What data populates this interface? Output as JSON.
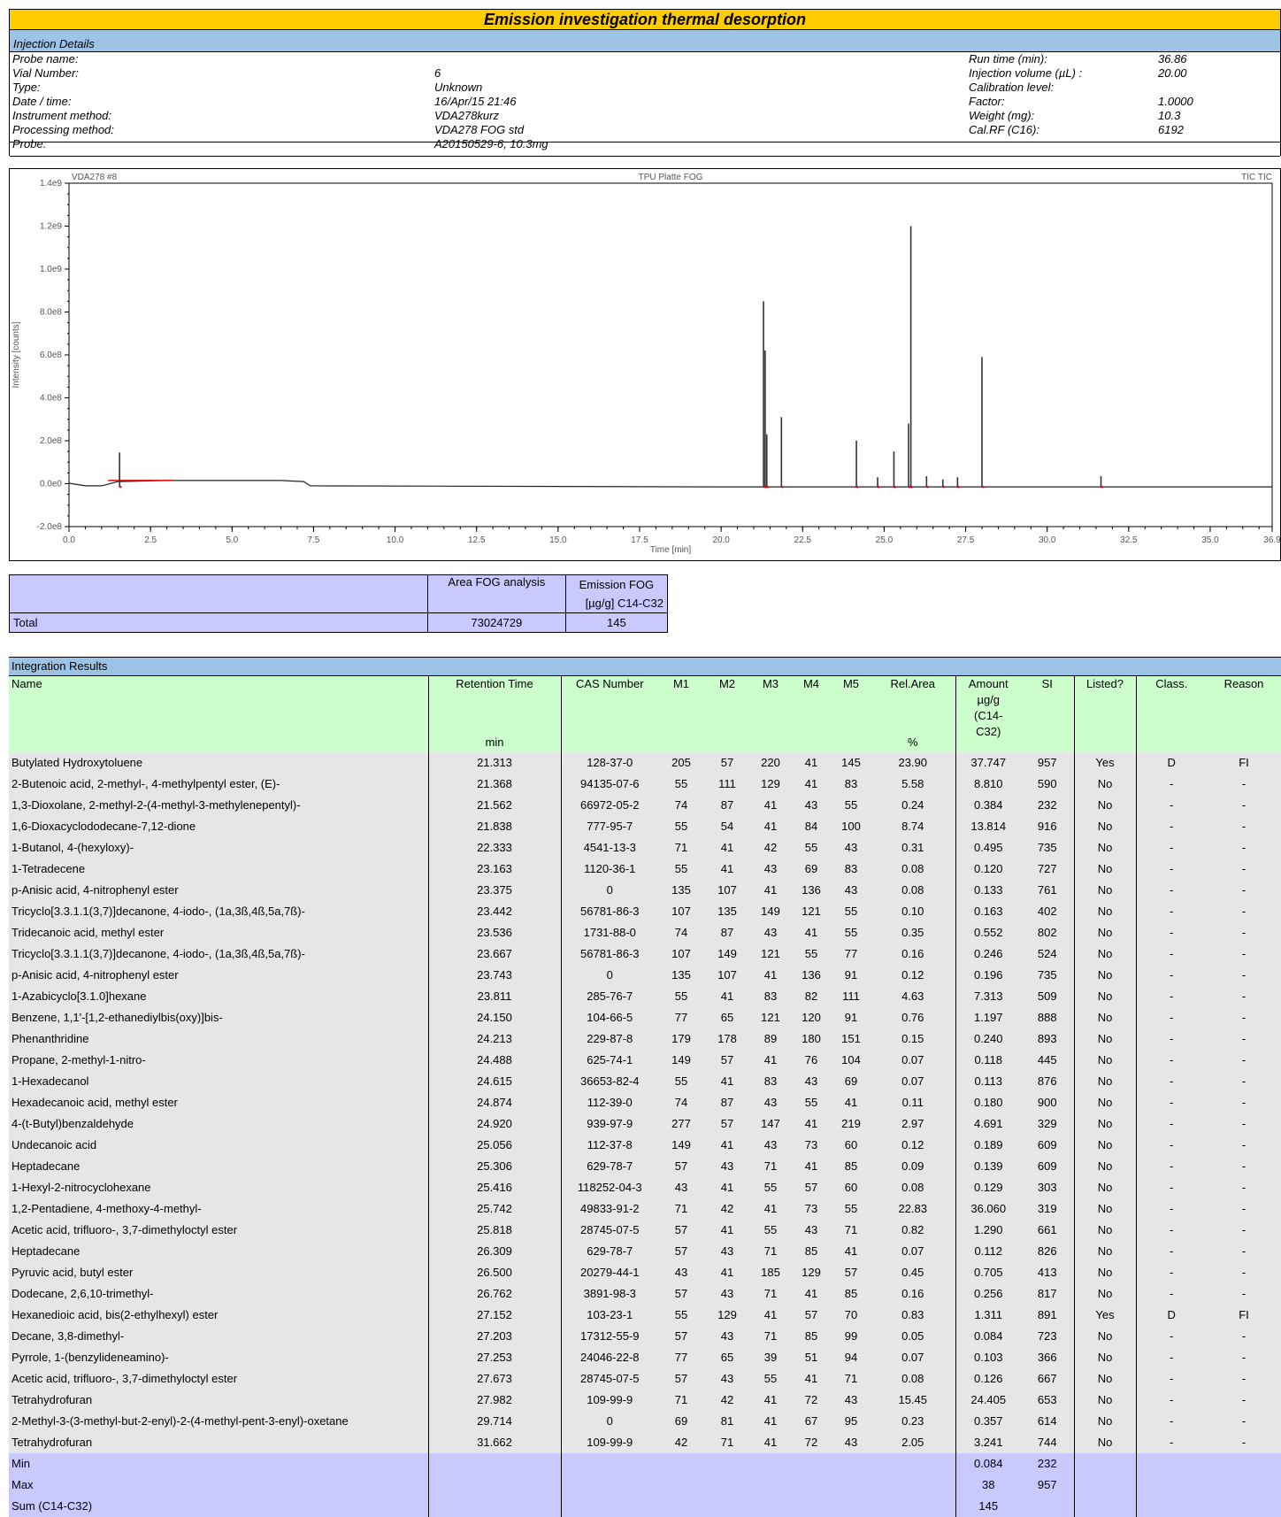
{
  "title": "Emission investigation thermal desorption",
  "injection": {
    "header": "Injection Details",
    "left_labels": [
      "Probe name:",
      "Vial Number:",
      "Type:",
      "Date / time:",
      "Instrument method:",
      "Processing method:",
      "Probe:"
    ],
    "left_values": [
      "",
      "6",
      "Unknown",
      "16/Apr/15 21:46",
      "VDA278kurz",
      "VDA278 FOG std",
      "A20150529-6, 10.3mg"
    ],
    "right_labels": [
      "Run time (min):",
      "Injection volume (µL) :",
      "Calibration level:",
      "Factor:",
      "Weight (mg):",
      "Cal.RF (C16):"
    ],
    "right_values": [
      "36.86",
      "20.00",
      "",
      "1.0000",
      "10.3",
      "6192"
    ]
  },
  "chart_data": {
    "type": "line",
    "title": "TPU Platte FOG",
    "corner_left": "VDA278 #8",
    "corner_right": "TIC TIC",
    "xlabel": "Time [min]",
    "ylabel": "Intensity [counts]",
    "xlim": [
      0,
      36.9
    ],
    "ylim": [
      -200000000.0,
      1400000000.0
    ],
    "x_ticks": [
      "0.0",
      "2.5",
      "5.0",
      "7.5",
      "10.0",
      "12.5",
      "15.0",
      "17.5",
      "20.0",
      "22.5",
      "25.0",
      "27.5",
      "30.0",
      "32.5",
      "35.0",
      "36.9"
    ],
    "y_ticks": [
      "1.4e9",
      "1.2e9",
      "1.0e9",
      "8.0e8",
      "6.0e8",
      "4.0e8",
      "2.0e8",
      "0.0e0",
      "-2.0e8"
    ],
    "baseline": [
      [
        0.0,
        2000000.0
      ],
      [
        0.5,
        -10000000.0
      ],
      [
        1.0,
        -10000000.0
      ],
      [
        1.5,
        10000000.0
      ],
      [
        3.0,
        15000000.0
      ],
      [
        6.5,
        15000000.0
      ],
      [
        7.2,
        10000000.0
      ],
      [
        7.4,
        -10000000.0
      ],
      [
        20.0,
        -15000000.0
      ],
      [
        36.9,
        -15000000.0
      ]
    ],
    "peaks": [
      [
        1.55,
        145000000.0
      ],
      [
        21.3,
        850000000.0
      ],
      [
        21.35,
        620000000.0
      ],
      [
        21.4,
        230000000.0
      ],
      [
        21.85,
        310000000.0
      ],
      [
        24.15,
        200000000.0
      ],
      [
        24.8,
        30000000.0
      ],
      [
        25.3,
        150000000.0
      ],
      [
        25.75,
        280000000.0
      ],
      [
        25.82,
        1200000000.0
      ],
      [
        26.3,
        35000000.0
      ],
      [
        26.8,
        20000000.0
      ],
      [
        27.25,
        30000000.0
      ],
      [
        28.0,
        590000000.0
      ],
      [
        31.65,
        35000000.0
      ]
    ]
  },
  "total": {
    "col1": "Area FOG analysis",
    "col2_line1": "Emission FOG",
    "col2_line2": "[µg/g] C14-C32",
    "row_label": "Total",
    "area": "73024729",
    "emission": "145"
  },
  "results": {
    "section": "Integration Results",
    "headers": {
      "name": "Name",
      "rt": "Retention Time",
      "rt_unit": "min",
      "cas": "CAS Number",
      "m1": "M1",
      "m2": "M2",
      "m3": "M3",
      "m4": "M4",
      "m5": "M5",
      "rel": "Rel.Area",
      "rel_unit": "%",
      "amount": "Amount",
      "amount_unit1": "µg/g",
      "amount_unit2": "(C14-",
      "amount_unit3": "C32)",
      "si": "SI",
      "listed": "Listed?",
      "class": "Class.",
      "reason": "Reason"
    },
    "rows": [
      [
        "Butylated Hydroxytoluene",
        "21.313",
        "128-37-0",
        "205",
        "57",
        "220",
        "41",
        "145",
        "23.90",
        "37.747",
        "957",
        "Yes",
        "D",
        "FI"
      ],
      [
        "2-Butenoic acid, 2-methyl-, 4-methylpentyl ester, (E)-",
        "21.368",
        "94135-07-6",
        "55",
        "111",
        "129",
        "41",
        "83",
        "5.58",
        "8.810",
        "590",
        "No",
        "-",
        "-"
      ],
      [
        "1,3-Dioxolane, 2-methyl-2-(4-methyl-3-methylenepentyl)-",
        "21.562",
        "66972-05-2",
        "74",
        "87",
        "41",
        "43",
        "55",
        "0.24",
        "0.384",
        "232",
        "No",
        "-",
        "-"
      ],
      [
        "1,6-Dioxacyclododecane-7,12-dione",
        "21.838",
        "777-95-7",
        "55",
        "54",
        "41",
        "84",
        "100",
        "8.74",
        "13.814",
        "916",
        "No",
        "-",
        "-"
      ],
      [
        "1-Butanol, 4-(hexyloxy)-",
        "22.333",
        "4541-13-3",
        "71",
        "41",
        "42",
        "55",
        "43",
        "0.31",
        "0.495",
        "735",
        "No",
        "-",
        "-"
      ],
      [
        "1-Tetradecene",
        "23.163",
        "1120-36-1",
        "55",
        "41",
        "43",
        "69",
        "83",
        "0.08",
        "0.120",
        "727",
        "No",
        "-",
        "-"
      ],
      [
        "p-Anisic acid, 4-nitrophenyl ester",
        "23.375",
        "0",
        "135",
        "107",
        "41",
        "136",
        "43",
        "0.08",
        "0.133",
        "761",
        "No",
        "-",
        "-"
      ],
      [
        "Tricyclo[3.3.1.1(3,7)]decanone, 4-iodo-, (1a,3ß,4ß,5a,7ß)-",
        "23.442",
        "56781-86-3",
        "107",
        "135",
        "149",
        "121",
        "55",
        "0.10",
        "0.163",
        "402",
        "No",
        "-",
        "-"
      ],
      [
        "Tridecanoic acid, methyl ester",
        "23.536",
        "1731-88-0",
        "74",
        "87",
        "43",
        "41",
        "55",
        "0.35",
        "0.552",
        "802",
        "No",
        "-",
        "-"
      ],
      [
        "Tricyclo[3.3.1.1(3,7)]decanone, 4-iodo-, (1a,3ß,4ß,5a,7ß)-",
        "23.667",
        "56781-86-3",
        "107",
        "149",
        "121",
        "55",
        "77",
        "0.16",
        "0.246",
        "524",
        "No",
        "-",
        "-"
      ],
      [
        "p-Anisic acid, 4-nitrophenyl ester",
        "23.743",
        "0",
        "135",
        "107",
        "41",
        "136",
        "91",
        "0.12",
        "0.196",
        "735",
        "No",
        "-",
        "-"
      ],
      [
        "1-Azabicyclo[3.1.0]hexane",
        "23.811",
        "285-76-7",
        "55",
        "41",
        "83",
        "82",
        "111",
        "4.63",
        "7.313",
        "509",
        "No",
        "-",
        "-"
      ],
      [
        "Benzene, 1,1'-[1,2-ethanediylbis(oxy)]bis-",
        "24.150",
        "104-66-5",
        "77",
        "65",
        "121",
        "120",
        "91",
        "0.76",
        "1.197",
        "888",
        "No",
        "-",
        "-"
      ],
      [
        "Phenanthridine",
        "24.213",
        "229-87-8",
        "179",
        "178",
        "89",
        "180",
        "151",
        "0.15",
        "0.240",
        "893",
        "No",
        "-",
        "-"
      ],
      [
        "Propane, 2-methyl-1-nitro-",
        "24.488",
        "625-74-1",
        "149",
        "57",
        "41",
        "76",
        "104",
        "0.07",
        "0.118",
        "445",
        "No",
        "-",
        "-"
      ],
      [
        "1-Hexadecanol",
        "24.615",
        "36653-82-4",
        "55",
        "41",
        "83",
        "43",
        "69",
        "0.07",
        "0.113",
        "876",
        "No",
        "-",
        "-"
      ],
      [
        "Hexadecanoic acid, methyl ester",
        "24.874",
        "112-39-0",
        "74",
        "87",
        "43",
        "55",
        "41",
        "0.11",
        "0.180",
        "900",
        "No",
        "-",
        "-"
      ],
      [
        "4-(t-Butyl)benzaldehyde",
        "24.920",
        "939-97-9",
        "277",
        "57",
        "147",
        "41",
        "219",
        "2.97",
        "4.691",
        "329",
        "No",
        "-",
        "-"
      ],
      [
        "Undecanoic acid",
        "25.056",
        "112-37-8",
        "149",
        "41",
        "43",
        "73",
        "60",
        "0.12",
        "0.189",
        "609",
        "No",
        "-",
        "-"
      ],
      [
        "Heptadecane",
        "25.306",
        "629-78-7",
        "57",
        "43",
        "71",
        "41",
        "85",
        "0.09",
        "0.139",
        "609",
        "No",
        "-",
        "-"
      ],
      [
        "1-Hexyl-2-nitrocyclohexane",
        "25.416",
        "118252-04-3",
        "43",
        "41",
        "55",
        "57",
        "60",
        "0.08",
        "0.129",
        "303",
        "No",
        "-",
        "-"
      ],
      [
        "1,2-Pentadiene, 4-methoxy-4-methyl-",
        "25.742",
        "49833-91-2",
        "71",
        "42",
        "41",
        "73",
        "55",
        "22.83",
        "36.060",
        "319",
        "No",
        "-",
        "-"
      ],
      [
        "Acetic acid, trifluoro-, 3,7-dimethyloctyl ester",
        "25.818",
        "28745-07-5",
        "57",
        "41",
        "55",
        "43",
        "71",
        "0.82",
        "1.290",
        "661",
        "No",
        "-",
        "-"
      ],
      [
        "Heptadecane",
        "26.309",
        "629-78-7",
        "57",
        "43",
        "71",
        "85",
        "41",
        "0.07",
        "0.112",
        "826",
        "No",
        "-",
        "-"
      ],
      [
        "Pyruvic acid, butyl ester",
        "26.500",
        "20279-44-1",
        "43",
        "41",
        "185",
        "129",
        "57",
        "0.45",
        "0.705",
        "413",
        "No",
        "-",
        "-"
      ],
      [
        "Dodecane, 2,6,10-trimethyl-",
        "26.762",
        "3891-98-3",
        "57",
        "43",
        "71",
        "41",
        "85",
        "0.16",
        "0.256",
        "817",
        "No",
        "-",
        "-"
      ],
      [
        "Hexanedioic acid, bis(2-ethylhexyl) ester",
        "27.152",
        "103-23-1",
        "55",
        "129",
        "41",
        "57",
        "70",
        "0.83",
        "1.311",
        "891",
        "Yes",
        "D",
        "FI"
      ],
      [
        "Decane, 3,8-dimethyl-",
        "27.203",
        "17312-55-9",
        "57",
        "43",
        "71",
        "85",
        "99",
        "0.05",
        "0.084",
        "723",
        "No",
        "-",
        "-"
      ],
      [
        "Pyrrole, 1-(benzylideneamino)-",
        "27.253",
        "24046-22-8",
        "77",
        "65",
        "39",
        "51",
        "94",
        "0.07",
        "0.103",
        "366",
        "No",
        "-",
        "-"
      ],
      [
        "Acetic acid, trifluoro-, 3,7-dimethyloctyl ester",
        "27.673",
        "28745-07-5",
        "57",
        "43",
        "55",
        "41",
        "71",
        "0.08",
        "0.126",
        "667",
        "No",
        "-",
        "-"
      ],
      [
        "Tetrahydrofuran",
        "27.982",
        "109-99-9",
        "71",
        "42",
        "41",
        "72",
        "43",
        "15.45",
        "24.405",
        "653",
        "No",
        "-",
        "-"
      ],
      [
        "2-Methyl-3-(3-methyl-but-2-enyl)-2-(4-methyl-pent-3-enyl)-oxetane",
        "29.714",
        "0",
        "69",
        "81",
        "41",
        "67",
        "95",
        "0.23",
        "0.357",
        "614",
        "No",
        "-",
        "-"
      ],
      [
        "Tetrahydrofuran",
        "31.662",
        "109-99-9",
        "42",
        "71",
        "41",
        "72",
        "43",
        "2.05",
        "3.241",
        "744",
        "No",
        "-",
        "-"
      ]
    ],
    "footer": [
      {
        "label": "Min",
        "amount": "0.084",
        "si": "232"
      },
      {
        "label": "Max",
        "amount": "38",
        "si": "957"
      },
      {
        "label": "Sum (C14-C32)",
        "amount": "145",
        "si": ""
      }
    ]
  }
}
